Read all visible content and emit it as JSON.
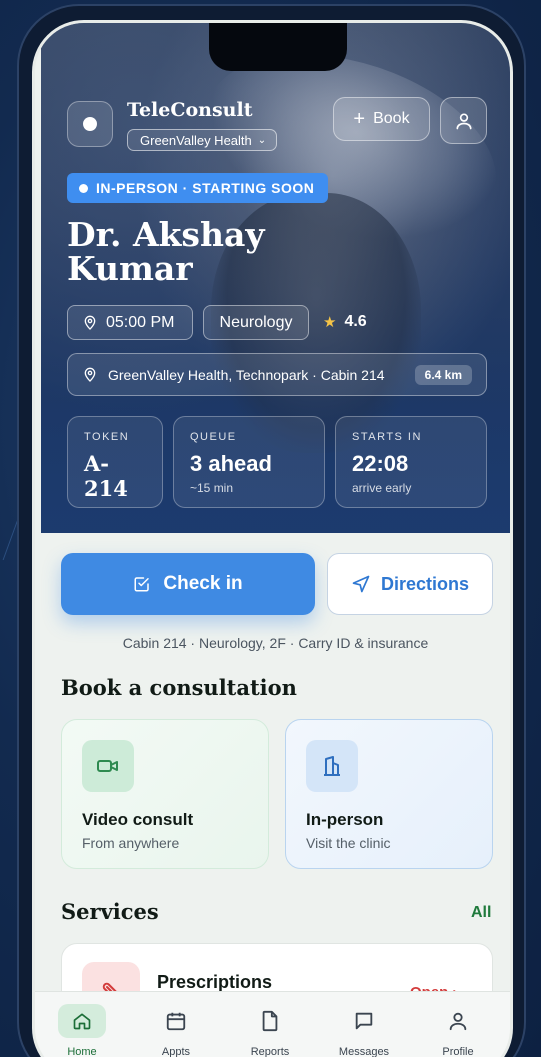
{
  "header": {
    "app_title": "TeleConsult",
    "org": "GreenValley Health",
    "book_label": "Book"
  },
  "status_chip": "IN-PERSON · STARTING SOON",
  "doctor": {
    "name": "Dr. Akshay Kumar",
    "time": "05:00 PM",
    "specialty": "Neurology",
    "rating": "4.6",
    "location": "GreenValley Health, Technopark · Cabin 214",
    "distance": "6.4 km"
  },
  "stats": {
    "token": {
      "label": "TOKEN",
      "value": "A-214"
    },
    "queue": {
      "label": "QUEUE",
      "value": "3 ahead",
      "sub": "~15 min"
    },
    "starts": {
      "label": "STARTS IN",
      "value": "22:08",
      "sub": "arrive early"
    }
  },
  "actions": {
    "checkin": "Check in",
    "directions": "Directions"
  },
  "hint": "Cabin 214 · Neurology, 2F · Carry ID & insurance",
  "book_section": {
    "title": "Book a consultation",
    "cards": [
      {
        "title": "Video consult",
        "subtitle": "From anywhere"
      },
      {
        "title": "In-person",
        "subtitle": "Visit the clinic"
      }
    ]
  },
  "services_section": {
    "title": "Services",
    "see_all": "All",
    "items": [
      {
        "title": "Prescriptions",
        "action": "Open ›"
      }
    ]
  },
  "tabs": [
    {
      "label": "Home",
      "icon": "home-icon"
    },
    {
      "label": "Appts",
      "icon": "calendar-icon"
    },
    {
      "label": "Reports",
      "icon": "file-icon"
    },
    {
      "label": "Messages",
      "icon": "message-icon"
    },
    {
      "label": "Profile",
      "icon": "user-icon"
    }
  ],
  "colors": {
    "accent_blue": "#3f8ae3",
    "brand_green": "#1f7a3c",
    "danger_red": "#d33b3b",
    "rating_star": "#f5c447"
  }
}
